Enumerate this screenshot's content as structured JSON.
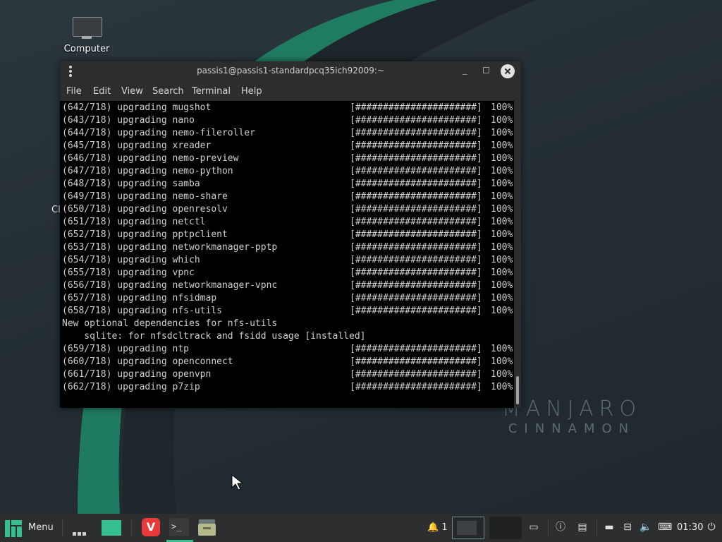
{
  "desktop": {
    "icon_computer_label": "Computer",
    "partial_label": "Cl",
    "brand_line1": "MANJARO",
    "brand_line2": "CINNAMON"
  },
  "terminal": {
    "title": "passis1@passis1-standardpcq35ich92009:~",
    "menu": [
      "File",
      "Edit",
      "View",
      "Search",
      "Terminal",
      "Help"
    ],
    "lines": [
      {
        "msg": "(642/718) upgrading mugshot",
        "bar": "[######################]",
        "pct": "100%"
      },
      {
        "msg": "(643/718) upgrading nano",
        "bar": "[######################]",
        "pct": "100%"
      },
      {
        "msg": "(644/718) upgrading nemo-fileroller",
        "bar": "[######################]",
        "pct": "100%"
      },
      {
        "msg": "(645/718) upgrading xreader",
        "bar": "[######################]",
        "pct": "100%"
      },
      {
        "msg": "(646/718) upgrading nemo-preview",
        "bar": "[######################]",
        "pct": "100%"
      },
      {
        "msg": "(647/718) upgrading nemo-python",
        "bar": "[######################]",
        "pct": "100%"
      },
      {
        "msg": "(648/718) upgrading samba",
        "bar": "[######################]",
        "pct": "100%"
      },
      {
        "msg": "(649/718) upgrading nemo-share",
        "bar": "[######################]",
        "pct": "100%"
      },
      {
        "msg": "(650/718) upgrading openresolv",
        "bar": "[######################]",
        "pct": "100%"
      },
      {
        "msg": "(651/718) upgrading netctl",
        "bar": "[######################]",
        "pct": "100%"
      },
      {
        "msg": "(652/718) upgrading pptpclient",
        "bar": "[######################]",
        "pct": "100%"
      },
      {
        "msg": "(653/718) upgrading networkmanager-pptp",
        "bar": "[######################]",
        "pct": "100%"
      },
      {
        "msg": "(654/718) upgrading which",
        "bar": "[######################]",
        "pct": "100%"
      },
      {
        "msg": "(655/718) upgrading vpnc",
        "bar": "[######################]",
        "pct": "100%"
      },
      {
        "msg": "(656/718) upgrading networkmanager-vpnc",
        "bar": "[######################]",
        "pct": "100%"
      },
      {
        "msg": "(657/718) upgrading nfsidmap",
        "bar": "[######################]",
        "pct": "100%"
      },
      {
        "msg": "(658/718) upgrading nfs-utils",
        "bar": "[######################]",
        "pct": "100%"
      },
      {
        "msg": "New optional dependencies for nfs-utils",
        "bar": "",
        "pct": ""
      },
      {
        "msg": "    sqlite: for nfsdcltrack and fsidd usage [installed]",
        "bar": "",
        "pct": ""
      },
      {
        "msg": "(659/718) upgrading ntp",
        "bar": "[######################]",
        "pct": "100%"
      },
      {
        "msg": "(660/718) upgrading openconnect",
        "bar": "[######################]",
        "pct": "100%"
      },
      {
        "msg": "(661/718) upgrading openvpn",
        "bar": "[######################]",
        "pct": "100%"
      },
      {
        "msg": "(662/718) upgrading p7zip",
        "bar": "[######################]",
        "pct": "100%"
      }
    ]
  },
  "taskbar": {
    "menu_label": "Menu",
    "notification_count": "1",
    "clock": "01:30",
    "accent": "#35bf8f"
  }
}
